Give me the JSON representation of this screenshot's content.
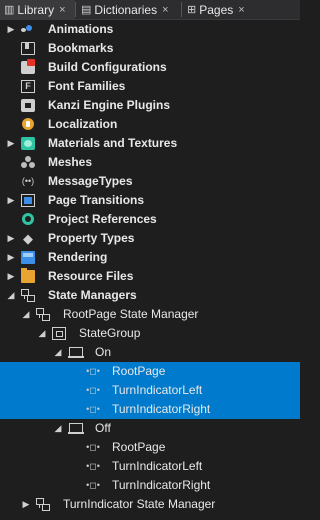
{
  "tabs": [
    {
      "label": "Library",
      "icon": "library-icon",
      "close": "×",
      "active": true
    },
    {
      "label": "Dictionaries",
      "icon": "dictionaries-icon",
      "close": "×",
      "active": false
    },
    {
      "label": "Pages",
      "icon": "pages-icon",
      "close": "×",
      "active": false
    }
  ],
  "tree": [
    {
      "label": "Animations",
      "icon": "animations-icon",
      "expander": "▶"
    },
    {
      "label": "Bookmarks",
      "icon": "bookmarks-icon",
      "expander": ""
    },
    {
      "label": "Build Configurations",
      "icon": "build-configurations-icon",
      "expander": ""
    },
    {
      "label": "Font Families",
      "icon": "font-families-icon",
      "expander": ""
    },
    {
      "label": "Kanzi Engine Plugins",
      "icon": "kanzi-engine-plugins-icon",
      "expander": ""
    },
    {
      "label": "Localization",
      "icon": "localization-icon",
      "expander": ""
    },
    {
      "label": "Materials and Textures",
      "icon": "materials-icon",
      "expander": "▶"
    },
    {
      "label": "Meshes",
      "icon": "meshes-icon",
      "expander": ""
    },
    {
      "label": "MessageTypes",
      "icon": "message-types-icon",
      "expander": ""
    },
    {
      "label": "Page Transitions",
      "icon": "page-transitions-icon",
      "expander": "▶"
    },
    {
      "label": "Project References",
      "icon": "project-references-icon",
      "expander": ""
    },
    {
      "label": "Property Types",
      "icon": "property-types-icon",
      "expander": "▶"
    },
    {
      "label": "Rendering",
      "icon": "rendering-icon",
      "expander": "▶"
    },
    {
      "label": "Resource Files",
      "icon": "resource-files-icon",
      "expander": "▶"
    },
    {
      "label": "State Managers",
      "icon": "state-managers-icon",
      "expander": "◢"
    },
    {
      "label": "RootPage State Manager",
      "icon": "state-manager-icon",
      "expander": "◢"
    },
    {
      "label": "StateGroup",
      "icon": "state-group-icon",
      "expander": "◢"
    },
    {
      "label": "On",
      "icon": "state-icon",
      "expander": "◢"
    },
    {
      "label": "RootPage",
      "icon": "property-value-icon",
      "expander": ""
    },
    {
      "label": "TurnIndicatorLeft",
      "icon": "property-value-icon",
      "expander": ""
    },
    {
      "label": "TurnIndicatorRight",
      "icon": "property-value-icon",
      "expander": ""
    },
    {
      "label": "Off",
      "icon": "state-icon",
      "expander": "◢"
    },
    {
      "label": "RootPage",
      "icon": "property-value-icon",
      "expander": ""
    },
    {
      "label": "TurnIndicatorLeft",
      "icon": "property-value-icon",
      "expander": ""
    },
    {
      "label": "TurnIndicatorRight",
      "icon": "property-value-icon",
      "expander": ""
    },
    {
      "label": "TurnIndicator State Manager",
      "icon": "state-manager-icon",
      "expander": "▶"
    }
  ],
  "glyphs": {
    "msg": "(••)",
    "prop": "◆",
    "font": "F",
    "pv": "•◻•"
  },
  "colors": {
    "selection": "#007acc",
    "accent": "#3c8ee8",
    "background": "#1e1e1e"
  }
}
